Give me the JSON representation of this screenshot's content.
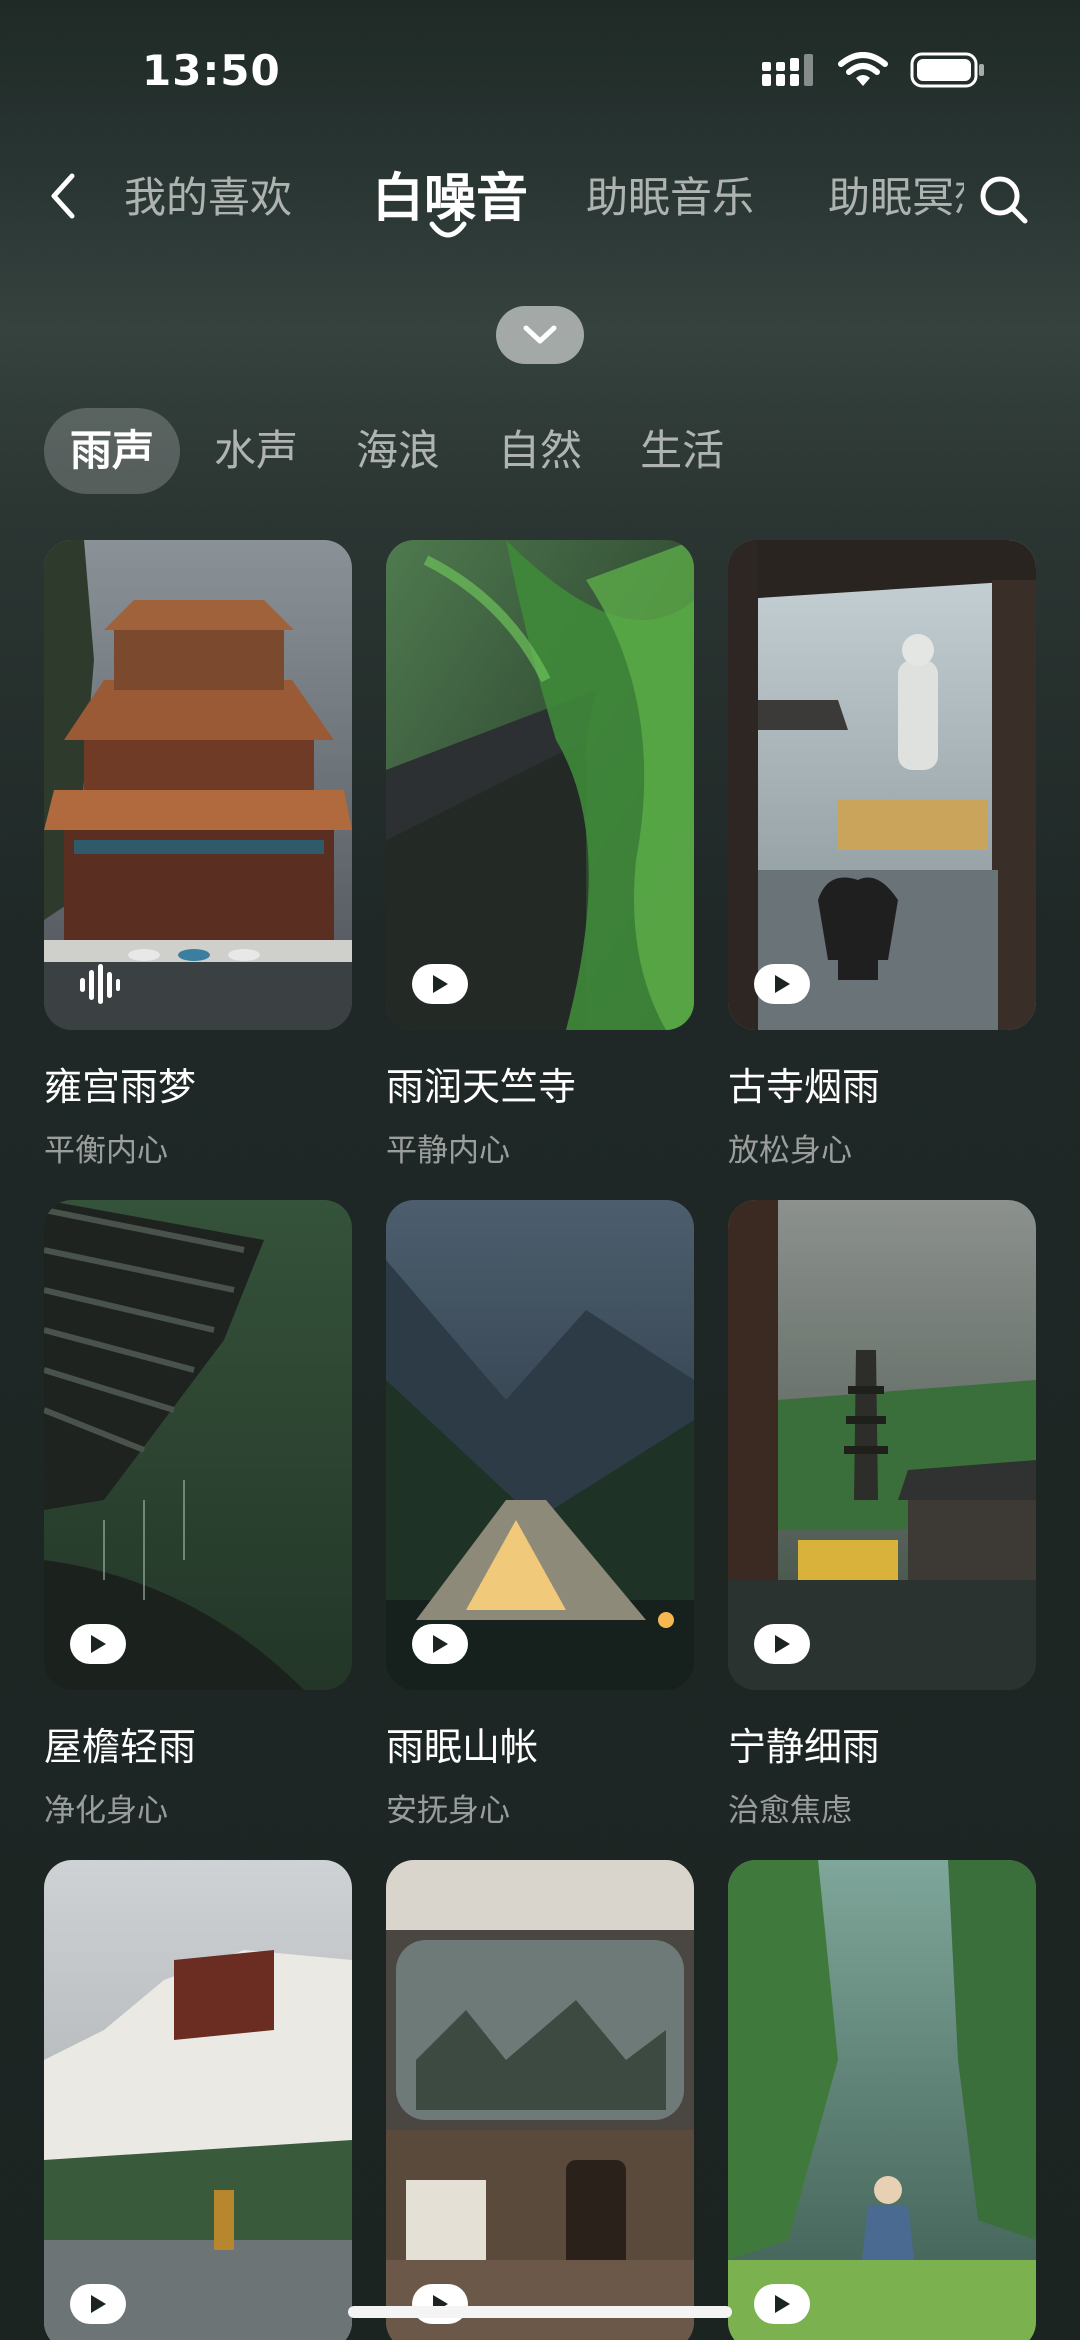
{
  "status_bar": {
    "time": "13:50",
    "icons": [
      "signal-icon",
      "wifi-icon",
      "battery-icon"
    ]
  },
  "top_nav": {
    "tabs": [
      {
        "label": "我的喜欢",
        "active": false
      },
      {
        "label": "白噪音",
        "active": true
      },
      {
        "label": "助眠音乐",
        "active": false
      },
      {
        "label": "助眠冥想",
        "active": false
      }
    ]
  },
  "categories": [
    {
      "label": "雨声",
      "active": true
    },
    {
      "label": "水声",
      "active": false
    },
    {
      "label": "海浪",
      "active": false
    },
    {
      "label": "自然",
      "active": false
    },
    {
      "label": "生活",
      "active": false
    }
  ],
  "cards": [
    {
      "title": "雍宫雨梦",
      "subtitle": "平衡内心",
      "state": "playing"
    },
    {
      "title": "雨润天竺寺",
      "subtitle": "平静内心",
      "state": "play"
    },
    {
      "title": "古寺烟雨",
      "subtitle": "放松身心",
      "state": "play"
    },
    {
      "title": "屋檐轻雨",
      "subtitle": "净化身心",
      "state": "play"
    },
    {
      "title": "雨眠山帐",
      "subtitle": "安抚身心",
      "state": "play"
    },
    {
      "title": "宁静细雨",
      "subtitle": "治愈焦虑",
      "state": "play"
    },
    {
      "title": "",
      "subtitle": "",
      "state": "play"
    },
    {
      "title": "",
      "subtitle": "",
      "state": "play"
    },
    {
      "title": "",
      "subtitle": "",
      "state": "play"
    }
  ],
  "colors": {
    "background": "#1f2826",
    "active_category_bg": "#4a5350",
    "text_primary": "#ffffff",
    "text_secondary": "#9aa09e"
  }
}
